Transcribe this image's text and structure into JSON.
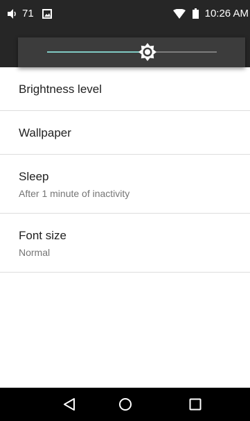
{
  "status_bar": {
    "volume_icon": "volume-icon",
    "volume_level": "71",
    "image_icon": "image-notification-icon",
    "wifi_icon": "wifi-icon",
    "battery_icon": "battery-icon",
    "time": "10:26 AM"
  },
  "brightness": {
    "level": 0.59,
    "track_color": "#7d7d7d",
    "fill_color": "#80cbc4",
    "thumb_icon": "brightness-icon"
  },
  "settings": [
    {
      "title": "Brightness level",
      "summary": ""
    },
    {
      "title": "Wallpaper",
      "summary": ""
    },
    {
      "title": "Sleep",
      "summary": "After 1 minute of inactivity"
    },
    {
      "title": "Font size",
      "summary": "Normal"
    }
  ],
  "nav_bar": {
    "back_icon": "back-icon",
    "home_icon": "home-icon",
    "recents_icon": "recents-icon"
  }
}
